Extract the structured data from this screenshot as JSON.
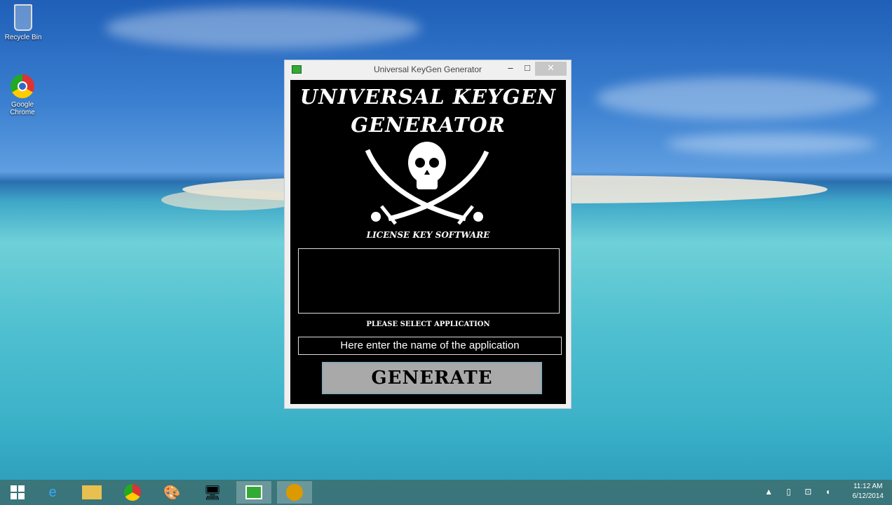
{
  "desktop": {
    "icons": [
      {
        "label": "Recycle Bin",
        "icon": "recycle-bin-icon"
      },
      {
        "label": "Google Chrome",
        "icon": "chrome-icon"
      }
    ]
  },
  "window": {
    "title": "Universal KeyGen Generator",
    "minimize": "–",
    "maximize": "□",
    "close": "✕",
    "heading_line1": "UNIVERSAL KEYGEN",
    "heading_line2": "GENERATOR",
    "subtitle": "LICENSE KEY SOFTWARE",
    "output_value": "",
    "select_label": "PLEASE SELECT APPLICATION",
    "app_input_value": "Here enter the name of the application",
    "generate_label": "GENERATE"
  },
  "taskbar": {
    "apps": [
      "start-icon",
      "internet-explorer-icon",
      "file-explorer-icon",
      "chrome-icon",
      "paint-icon",
      "network-icon",
      "keygen-app-icon",
      "app-icon"
    ],
    "time": "11:12 AM",
    "date": "6/12/2014"
  }
}
